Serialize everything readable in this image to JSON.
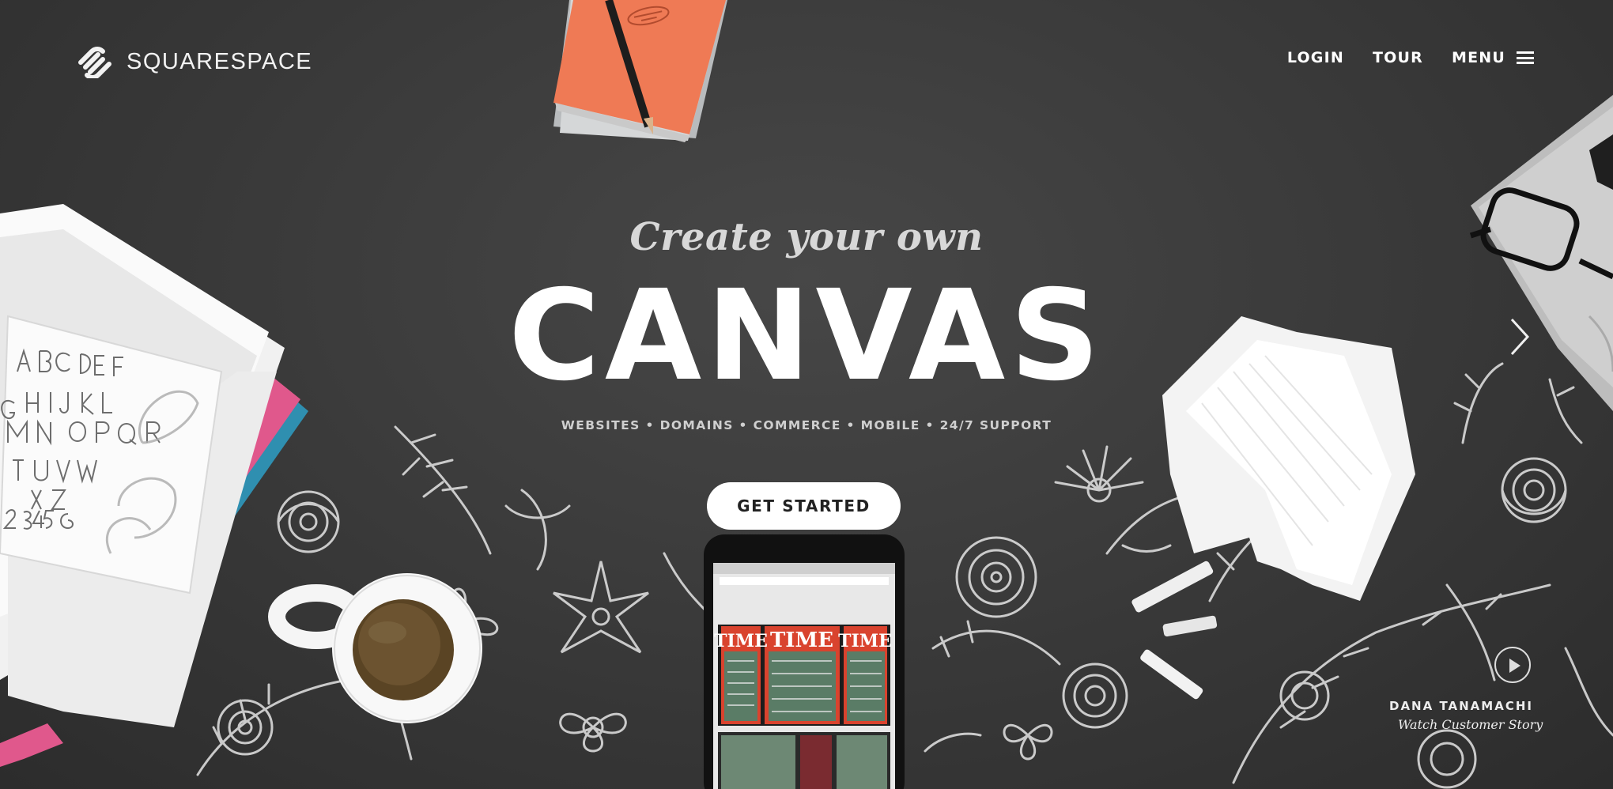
{
  "brand": {
    "name": "SQUARESPACE",
    "logo_icon": "squarespace-logo-icon"
  },
  "nav": {
    "login": "LOGIN",
    "tour": "TOUR",
    "menu": "MENU",
    "menu_icon": "hamburger-icon"
  },
  "hero": {
    "subtitle": "Create your own",
    "title": "CANVAS",
    "features": "WEBSITES • DOMAINS • COMMERCE • MOBILE • 24/7 SUPPORT",
    "cta": "GET STARTED"
  },
  "caption": {
    "name": "DANA TANAMACHI",
    "link": "Watch Customer Story",
    "play_icon": "play-icon"
  },
  "screen_mockup": {
    "magazine_word": "TIME"
  },
  "colors": {
    "background": "#3a3a3a",
    "cta_bg": "#ffffff",
    "notebook": "#ef7a55",
    "magazine_red": "#d9432e"
  }
}
